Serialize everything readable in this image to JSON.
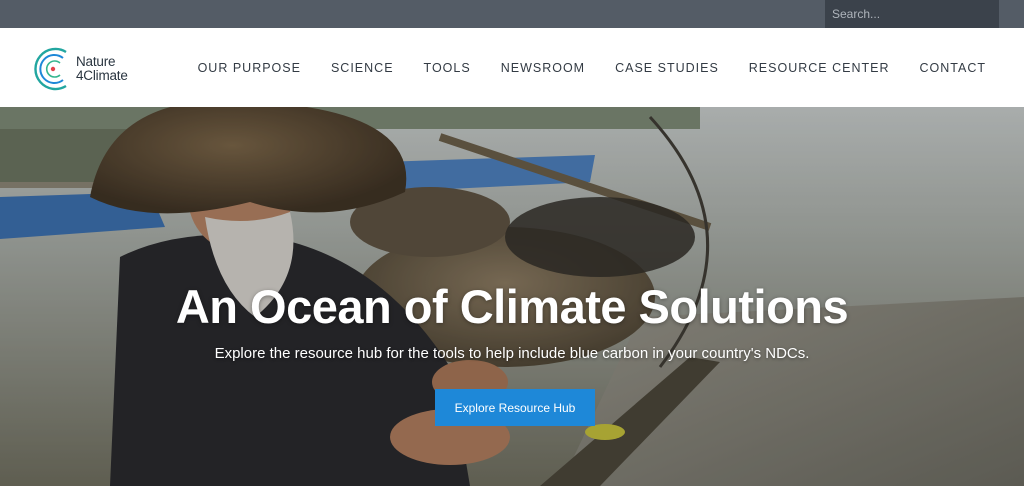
{
  "search": {
    "placeholder": "Search..."
  },
  "brand": {
    "line1": "Nature",
    "line2": "4Climate"
  },
  "nav": {
    "items": [
      {
        "label": "OUR PURPOSE"
      },
      {
        "label": "SCIENCE"
      },
      {
        "label": "TOOLS"
      },
      {
        "label": "NEWSROOM"
      },
      {
        "label": "CASE STUDIES"
      },
      {
        "label": "RESOURCE CENTER"
      },
      {
        "label": "CONTACT"
      }
    ]
  },
  "hero": {
    "title": "An Ocean of Climate Solutions",
    "subtitle": "Explore the resource hub for the tools to help include blue carbon in your country's NDCs.",
    "button_label": "Explore Resource Hub"
  },
  "colors": {
    "topbar": "#545c66",
    "search_bg": "#3b424b",
    "accent_button": "#1e88d8",
    "logo_teal": "#22a6a0",
    "logo_blue": "#1e88d8",
    "logo_dot": "#e2424a"
  }
}
